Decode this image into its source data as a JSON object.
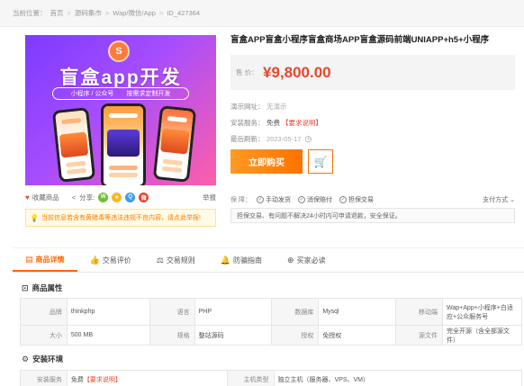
{
  "breadcrumb": {
    "prefix": "当前位置：",
    "items": [
      "首页",
      "源码集市",
      "Wap/微信/App",
      "ID_427364"
    ]
  },
  "gallery": {
    "banner_title": "盲盒app开发",
    "banner_tags": [
      "小程序 / 公众号",
      "按需求定制开发"
    ],
    "logo_glyph": "S"
  },
  "actions": {
    "favorite_label": "收藏商品",
    "share_label": "分享:",
    "social_icons": [
      "wechat-icon",
      "qzone-icon",
      "qq-icon",
      "weibo-icon"
    ],
    "report_label": "举报"
  },
  "notice": {
    "text": "当前信息若含有黄赌毒等违法违规不良内容，请点此举报!"
  },
  "product": {
    "title": "盲盒APP盲盒小程序盲盒商场APP盲盒源码前端UNIAPP+h5+小程序",
    "price_label": "售 价：",
    "price": "¥9,800.00",
    "demo_label": "演示网址：",
    "demo_value": "无演示",
    "install_label": "安装服务：",
    "install_value": "免费",
    "install_tip": "【要求说明】",
    "refresh_label": "最后刷新：",
    "refresh_value": "2023-05-17",
    "buy_label": "立即购买",
    "cart_icon": "cart-icon"
  },
  "guarantee": {
    "label": "保  障：",
    "items": [
      "手动发货",
      "消保赔付",
      "担保交易"
    ],
    "pay_label": "支付方式",
    "note": "担保交易、有问题不解决24小时内可申请退款，安全保证。"
  },
  "tabs": [
    {
      "label": "商品详情",
      "icon": "document-icon",
      "active": true
    },
    {
      "label": "交易评价",
      "icon": "thumbs-up-icon",
      "active": false
    },
    {
      "label": "交易规则",
      "icon": "scale-icon",
      "active": false
    },
    {
      "label": "防骗指南",
      "icon": "bell-icon",
      "active": false
    },
    {
      "label": "买家必读",
      "icon": "plus-circle-icon",
      "active": false
    }
  ],
  "attributes": {
    "title": "商品属性",
    "rows": [
      [
        {
          "k": "品牌",
          "v": "thinkphp"
        },
        {
          "k": "语言",
          "v": "PHP"
        },
        {
          "k": "数据库",
          "v": "Mysql"
        },
        {
          "k": "移动端",
          "v": "Wap+App+小程序+白适应+公众服务号"
        }
      ],
      [
        {
          "k": "大小",
          "v": "500 MB"
        },
        {
          "k": "规格",
          "v": "整站源码"
        },
        {
          "k": "授权",
          "v": "免授权"
        },
        {
          "k": "源文件",
          "v": "完全开源（含全部源文件）"
        }
      ]
    ]
  },
  "environment": {
    "title": "安装环境",
    "service_label": "安装服务",
    "service_value": "免费",
    "service_tip": "【要求说明】",
    "host_label": "主机类型",
    "host_value": "独立主机（服务器、VPS、VM）"
  },
  "colors": {
    "accent": "#ff6600",
    "price": "#e8472b",
    "banner_start": "#7d3bff",
    "banner_end": "#ff5fa8"
  }
}
